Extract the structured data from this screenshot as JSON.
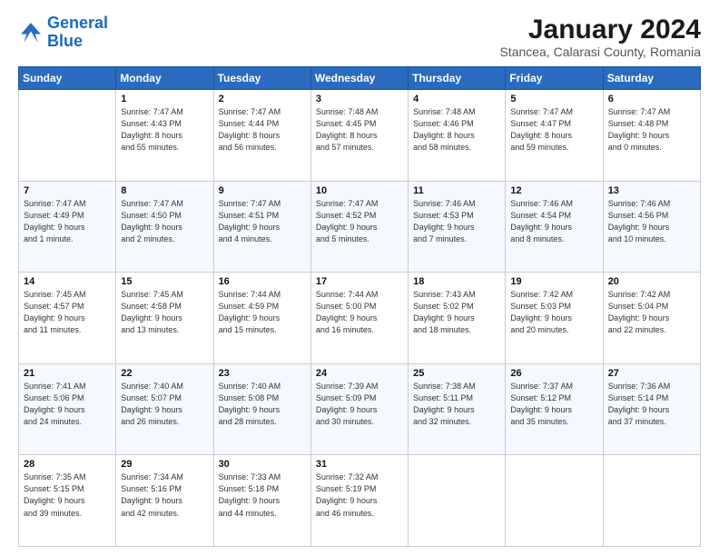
{
  "header": {
    "logo_line1": "General",
    "logo_line2": "Blue",
    "main_title": "January 2024",
    "subtitle": "Stancea, Calarasi County, Romania"
  },
  "days_of_week": [
    "Sunday",
    "Monday",
    "Tuesday",
    "Wednesday",
    "Thursday",
    "Friday",
    "Saturday"
  ],
  "weeks": [
    [
      {
        "day": "",
        "content": ""
      },
      {
        "day": "1",
        "content": "Sunrise: 7:47 AM\nSunset: 4:43 PM\nDaylight: 8 hours\nand 55 minutes."
      },
      {
        "day": "2",
        "content": "Sunrise: 7:47 AM\nSunset: 4:44 PM\nDaylight: 8 hours\nand 56 minutes."
      },
      {
        "day": "3",
        "content": "Sunrise: 7:48 AM\nSunset: 4:45 PM\nDaylight: 8 hours\nand 57 minutes."
      },
      {
        "day": "4",
        "content": "Sunrise: 7:48 AM\nSunset: 4:46 PM\nDaylight: 8 hours\nand 58 minutes."
      },
      {
        "day": "5",
        "content": "Sunrise: 7:47 AM\nSunset: 4:47 PM\nDaylight: 8 hours\nand 59 minutes."
      },
      {
        "day": "6",
        "content": "Sunrise: 7:47 AM\nSunset: 4:48 PM\nDaylight: 9 hours\nand 0 minutes."
      }
    ],
    [
      {
        "day": "7",
        "content": "Sunrise: 7:47 AM\nSunset: 4:49 PM\nDaylight: 9 hours\nand 1 minute."
      },
      {
        "day": "8",
        "content": "Sunrise: 7:47 AM\nSunset: 4:50 PM\nDaylight: 9 hours\nand 2 minutes."
      },
      {
        "day": "9",
        "content": "Sunrise: 7:47 AM\nSunset: 4:51 PM\nDaylight: 9 hours\nand 4 minutes."
      },
      {
        "day": "10",
        "content": "Sunrise: 7:47 AM\nSunset: 4:52 PM\nDaylight: 9 hours\nand 5 minutes."
      },
      {
        "day": "11",
        "content": "Sunrise: 7:46 AM\nSunset: 4:53 PM\nDaylight: 9 hours\nand 7 minutes."
      },
      {
        "day": "12",
        "content": "Sunrise: 7:46 AM\nSunset: 4:54 PM\nDaylight: 9 hours\nand 8 minutes."
      },
      {
        "day": "13",
        "content": "Sunrise: 7:46 AM\nSunset: 4:56 PM\nDaylight: 9 hours\nand 10 minutes."
      }
    ],
    [
      {
        "day": "14",
        "content": "Sunrise: 7:45 AM\nSunset: 4:57 PM\nDaylight: 9 hours\nand 11 minutes."
      },
      {
        "day": "15",
        "content": "Sunrise: 7:45 AM\nSunset: 4:58 PM\nDaylight: 9 hours\nand 13 minutes."
      },
      {
        "day": "16",
        "content": "Sunrise: 7:44 AM\nSunset: 4:59 PM\nDaylight: 9 hours\nand 15 minutes."
      },
      {
        "day": "17",
        "content": "Sunrise: 7:44 AM\nSunset: 5:00 PM\nDaylight: 9 hours\nand 16 minutes."
      },
      {
        "day": "18",
        "content": "Sunrise: 7:43 AM\nSunset: 5:02 PM\nDaylight: 9 hours\nand 18 minutes."
      },
      {
        "day": "19",
        "content": "Sunrise: 7:42 AM\nSunset: 5:03 PM\nDaylight: 9 hours\nand 20 minutes."
      },
      {
        "day": "20",
        "content": "Sunrise: 7:42 AM\nSunset: 5:04 PM\nDaylight: 9 hours\nand 22 minutes."
      }
    ],
    [
      {
        "day": "21",
        "content": "Sunrise: 7:41 AM\nSunset: 5:06 PM\nDaylight: 9 hours\nand 24 minutes."
      },
      {
        "day": "22",
        "content": "Sunrise: 7:40 AM\nSunset: 5:07 PM\nDaylight: 9 hours\nand 26 minutes."
      },
      {
        "day": "23",
        "content": "Sunrise: 7:40 AM\nSunset: 5:08 PM\nDaylight: 9 hours\nand 28 minutes."
      },
      {
        "day": "24",
        "content": "Sunrise: 7:39 AM\nSunset: 5:09 PM\nDaylight: 9 hours\nand 30 minutes."
      },
      {
        "day": "25",
        "content": "Sunrise: 7:38 AM\nSunset: 5:11 PM\nDaylight: 9 hours\nand 32 minutes."
      },
      {
        "day": "26",
        "content": "Sunrise: 7:37 AM\nSunset: 5:12 PM\nDaylight: 9 hours\nand 35 minutes."
      },
      {
        "day": "27",
        "content": "Sunrise: 7:36 AM\nSunset: 5:14 PM\nDaylight: 9 hours\nand 37 minutes."
      }
    ],
    [
      {
        "day": "28",
        "content": "Sunrise: 7:35 AM\nSunset: 5:15 PM\nDaylight: 9 hours\nand 39 minutes."
      },
      {
        "day": "29",
        "content": "Sunrise: 7:34 AM\nSunset: 5:16 PM\nDaylight: 9 hours\nand 42 minutes."
      },
      {
        "day": "30",
        "content": "Sunrise: 7:33 AM\nSunset: 5:18 PM\nDaylight: 9 hours\nand 44 minutes."
      },
      {
        "day": "31",
        "content": "Sunrise: 7:32 AM\nSunset: 5:19 PM\nDaylight: 9 hours\nand 46 minutes."
      },
      {
        "day": "",
        "content": ""
      },
      {
        "day": "",
        "content": ""
      },
      {
        "day": "",
        "content": ""
      }
    ]
  ]
}
